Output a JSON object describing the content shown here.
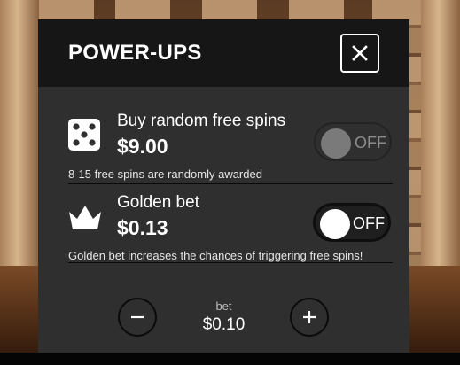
{
  "modal": {
    "title": "POWER-UPS",
    "close_icon": "close-icon"
  },
  "powerups": [
    {
      "icon": "dice-icon",
      "name": "Buy random free spins",
      "price": "$9.00",
      "description": "8-15 free spins are randomly awarded",
      "toggle_label": "OFF",
      "toggle_state": "disabled"
    },
    {
      "icon": "crown-icon",
      "name": "Golden bet",
      "price": "$0.13",
      "description": "Golden bet increases the chances of triggering free spins!",
      "toggle_label": "OFF",
      "toggle_state": "off"
    }
  ],
  "bet": {
    "label": "bet",
    "value": "$0.10",
    "decrease_icon": "minus-icon",
    "increase_icon": "plus-icon"
  }
}
